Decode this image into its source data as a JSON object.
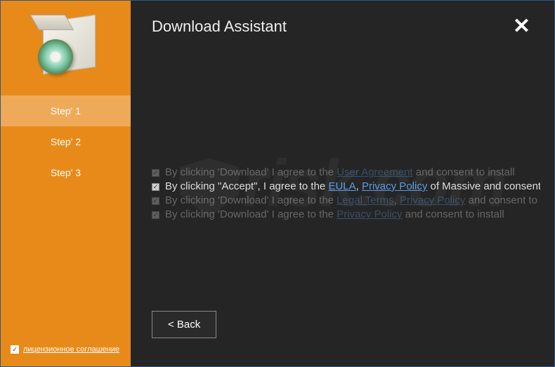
{
  "header": {
    "title": "Download Assistant"
  },
  "sidebar": {
    "steps": [
      {
        "label": "Step' 1",
        "active": true
      },
      {
        "label": "Step' 2",
        "active": false
      },
      {
        "label": "Step' 3",
        "active": false
      }
    ],
    "license": {
      "checked": true,
      "label": "лицензионное соглашение"
    }
  },
  "consent": {
    "rows": [
      {
        "prefix": "By clicking 'Download' I agree to the ",
        "links": [
          {
            "text": "User Agreement"
          }
        ],
        "suffix": " and consent to install",
        "faded": true
      },
      {
        "prefix": "By clicking \"Accept\", I agree to the ",
        "links": [
          {
            "text": "EULA"
          },
          {
            "text": "Privacy Policy"
          }
        ],
        "link_separator": ", ",
        "suffix": " of Massive and consent",
        "faded": false
      },
      {
        "prefix": "By clicking 'Download' I agree to the ",
        "links": [
          {
            "text": "Legal Terms"
          },
          {
            "text": "Privacy Policy"
          }
        ],
        "link_separator": ", ",
        "suffix": " and consent to",
        "faded": true
      },
      {
        "prefix": "By clicking 'Download' I agree to the ",
        "links": [
          {
            "text": "Privacy Policy"
          }
        ],
        "suffix": " and consent to install",
        "faded": true
      }
    ]
  },
  "buttons": {
    "back": "<  Back"
  },
  "watermark": {
    "text": "risk.com"
  }
}
